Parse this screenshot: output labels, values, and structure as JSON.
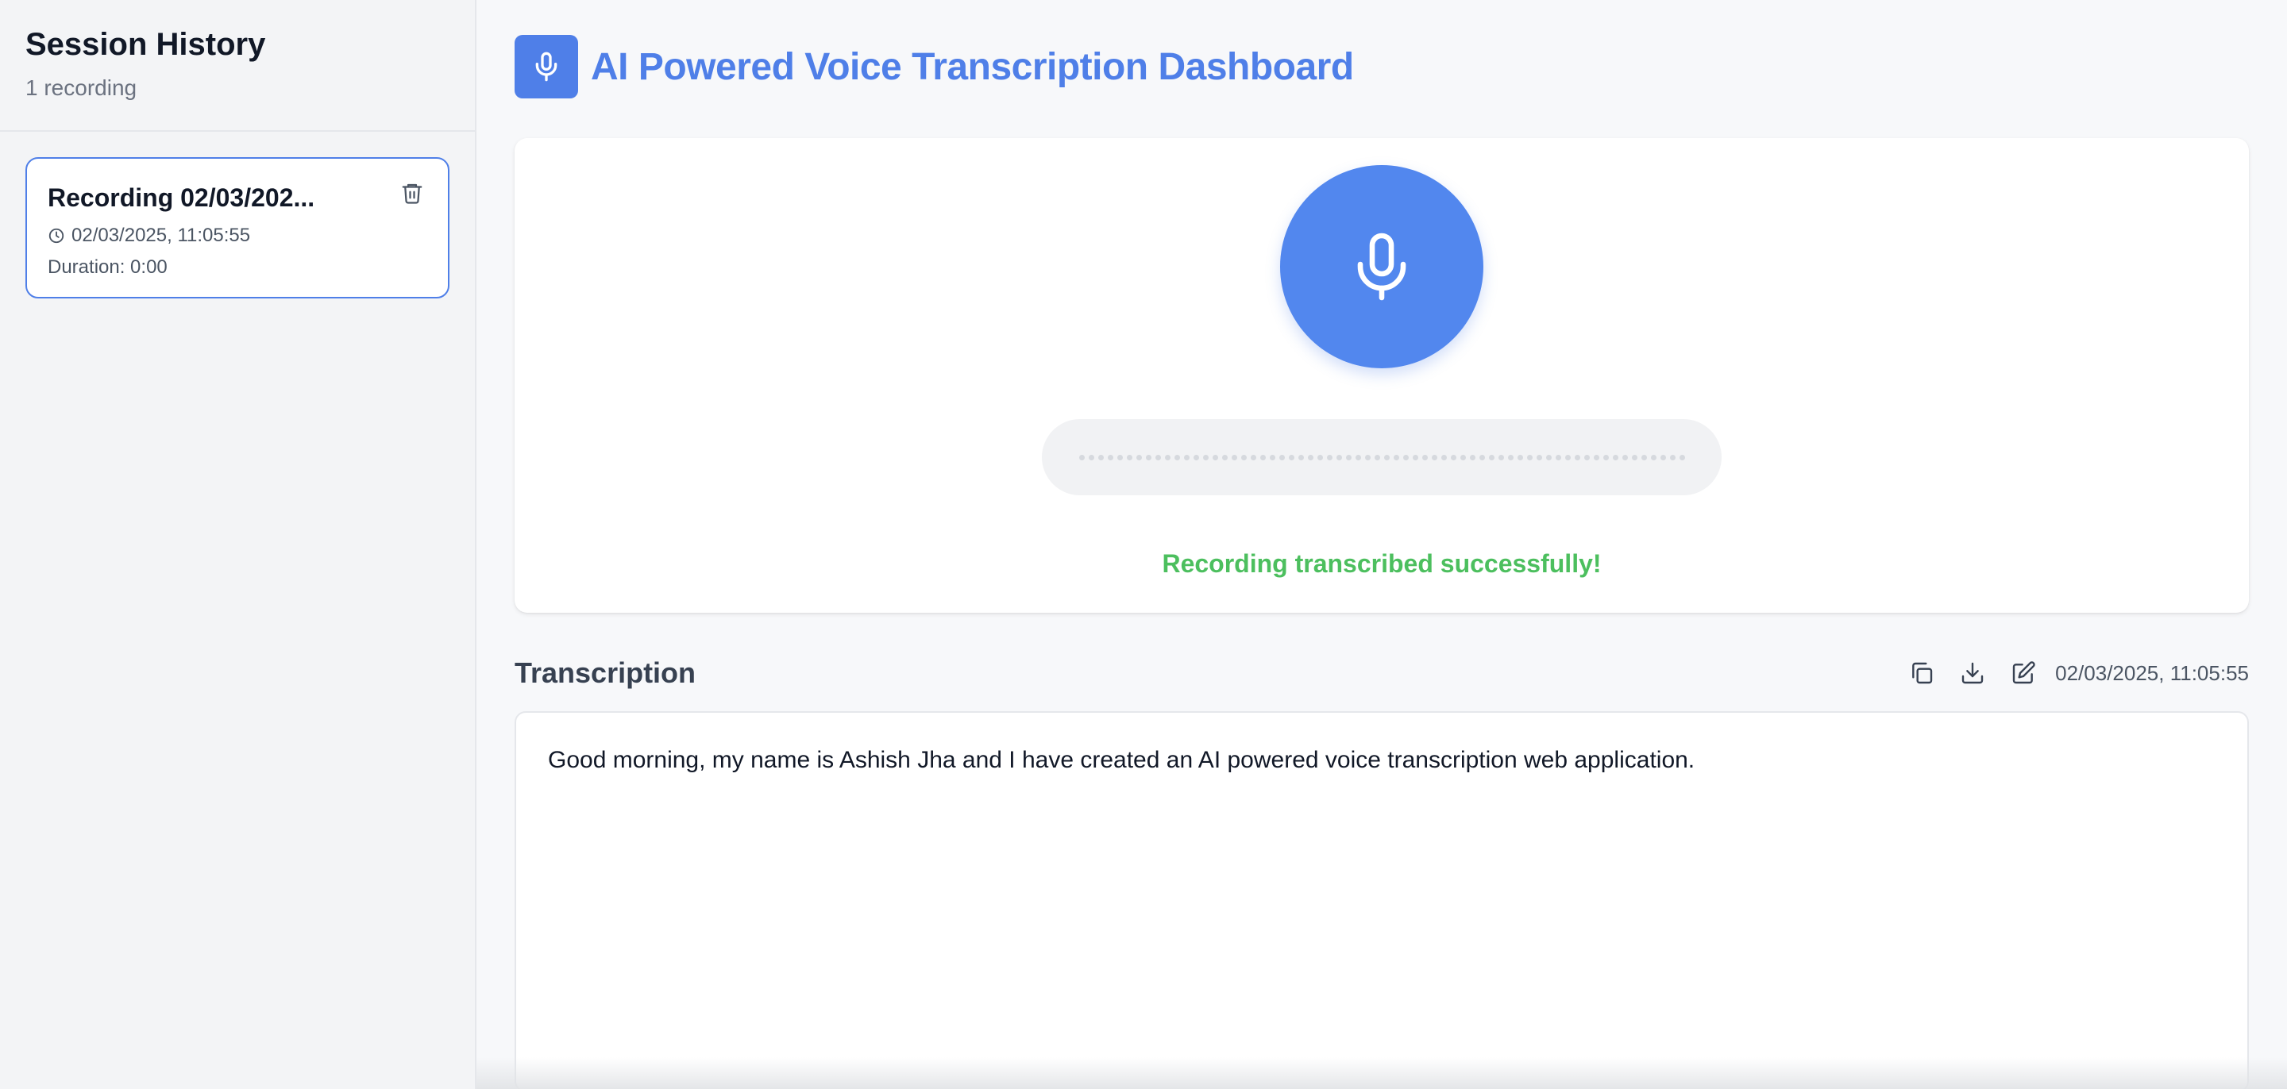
{
  "sidebar": {
    "title": "Session History",
    "count": "1 recording",
    "sessions": [
      {
        "name": "Recording 02/03/202...",
        "datetime": "02/03/2025, 11:05:55",
        "duration": "Duration: 0:00"
      }
    ]
  },
  "header": {
    "title": "AI Powered Voice Transcription Dashboard",
    "logo_icon": "microphone-icon"
  },
  "recorder": {
    "button_icon": "microphone-icon",
    "status": "Recording transcribed successfully!"
  },
  "transcription": {
    "title": "Transcription",
    "timestamp": "02/03/2025, 11:05:55",
    "actions": [
      "copy-icon",
      "download-icon",
      "edit-icon"
    ],
    "text": "Good morning, my name is Ashish Jha and I have created an AI powered voice transcription web application."
  },
  "colors": {
    "accent": "#4f7fe8",
    "mic_button": "#5287ee",
    "success": "#4cbf5e",
    "sidebar_bg": "#f3f4f6"
  }
}
